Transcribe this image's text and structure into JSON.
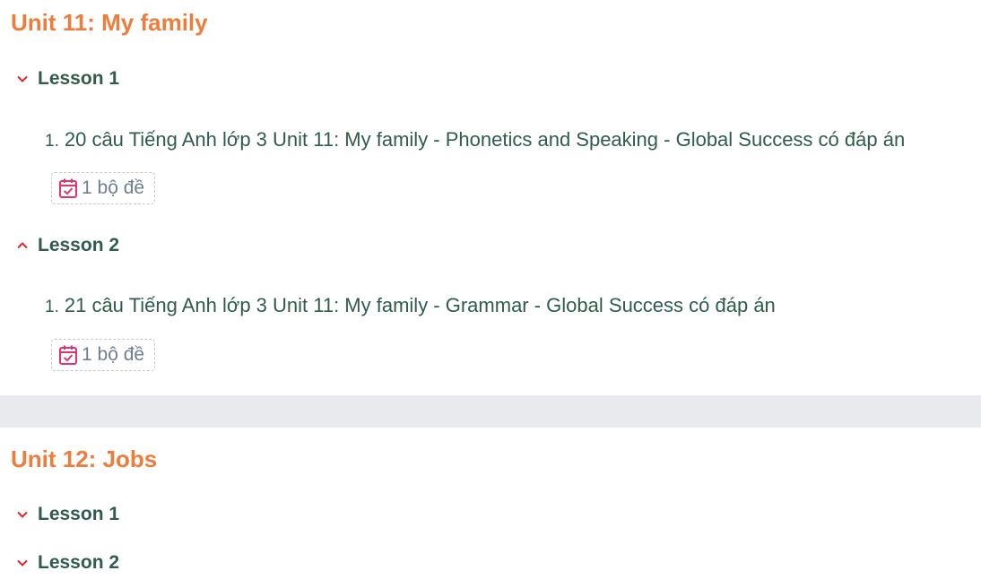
{
  "units": [
    {
      "title": "Unit 11: My family",
      "lessons": [
        {
          "label": "Lesson 1",
          "state": "collapsed-chevron-down",
          "items": [
            {
              "number": "1.",
              "title": "20 câu Tiếng Anh lớp 3 Unit 11: My family - Phonetics and Speaking - Global Success có đáp án",
              "badge": "1 bộ đề"
            }
          ]
        },
        {
          "label": "Lesson 2",
          "state": "expanded-chevron-up",
          "items": [
            {
              "number": "1.",
              "title": "21 câu Tiếng Anh lớp 3 Unit 11: My family - Grammar - Global Success có đáp án",
              "badge": "1 bộ đề"
            }
          ]
        }
      ]
    },
    {
      "title": "Unit 12: Jobs",
      "lessons": [
        {
          "label": "Lesson 1",
          "state": "collapsed-chevron-down"
        },
        {
          "label": "Lesson 2",
          "state": "collapsed-chevron-down"
        }
      ]
    }
  ],
  "icons": {
    "chevron_down": "chevron-down-icon",
    "chevron_up": "chevron-up-icon",
    "badge": "calendar-check-icon"
  },
  "colors": {
    "unit_title": "#ee7d3b",
    "lesson_text": "#2f5d4a",
    "chevron": "#e0242b",
    "badge_icon": "#e3336b",
    "badge_text": "#6f7f8f",
    "separator": "#e9eaed"
  }
}
